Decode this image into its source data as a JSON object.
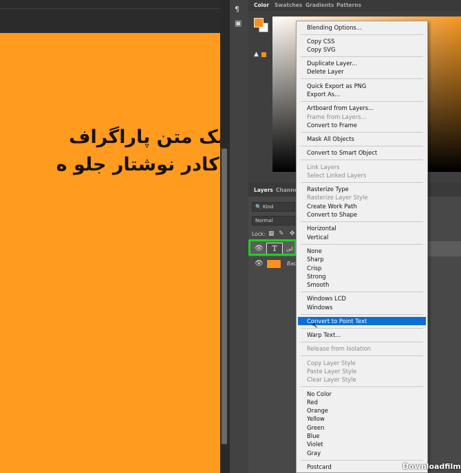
{
  "canvas": {
    "line1": "این یک متن پاراگراف",
    "line2": "توی کادر نوشتار جلو ه"
  },
  "color_panel": {
    "tabs": [
      "Color",
      "Swatches",
      "Gradients",
      "Patterns"
    ],
    "foreground_color": "#f7901e"
  },
  "layers_panel": {
    "tabs": [
      "Layers",
      "Channels"
    ],
    "kind_filter": "Kind",
    "blend_mode": "Normal",
    "lock_label": "Lock:",
    "text_layer": {
      "thumb": "T",
      "name": "این"
    },
    "background_layer": {
      "name": "Back"
    }
  },
  "context_menu": {
    "items": [
      {
        "label": "Blending Options...",
        "disabled": false
      },
      {
        "label": "Copy CSS",
        "disabled": false
      },
      {
        "label": "Copy SVG",
        "disabled": false
      },
      {
        "label": "Duplicate Layer...",
        "disabled": false
      },
      {
        "label": "Delete Layer",
        "disabled": false
      },
      {
        "label": "Quick Export as PNG",
        "disabled": false
      },
      {
        "label": "Export As...",
        "disabled": false
      },
      {
        "label": "Artboard from Layers...",
        "disabled": false
      },
      {
        "label": "Frame from Layers...",
        "disabled": true
      },
      {
        "label": "Convert to Frame",
        "disabled": false
      },
      {
        "label": "Mask All Objects",
        "disabled": false
      },
      {
        "label": "Convert to Smart Object",
        "disabled": false
      },
      {
        "label": "Link Layers",
        "disabled": true
      },
      {
        "label": "Select Linked Layers",
        "disabled": true
      },
      {
        "label": "Rasterize Type",
        "disabled": false
      },
      {
        "label": "Rasterize Layer Style",
        "disabled": true
      },
      {
        "label": "Create Work Path",
        "disabled": false
      },
      {
        "label": "Convert to Shape",
        "disabled": false
      },
      {
        "label": "Horizontal",
        "disabled": false
      },
      {
        "label": "Vertical",
        "disabled": false
      },
      {
        "label": "None",
        "disabled": false
      },
      {
        "label": "Sharp",
        "disabled": false
      },
      {
        "label": "Crisp",
        "disabled": false
      },
      {
        "label": "Strong",
        "disabled": false
      },
      {
        "label": "Smooth",
        "disabled": false
      },
      {
        "label": "Windows LCD",
        "disabled": false
      },
      {
        "label": "Windows",
        "disabled": false
      },
      {
        "label": "Convert to Point Text",
        "disabled": false,
        "selected": true
      },
      {
        "label": "Warp Text...",
        "disabled": false
      },
      {
        "label": "Release from Isolation",
        "disabled": true
      },
      {
        "label": "Copy Layer Style",
        "disabled": true
      },
      {
        "label": "Paste Layer Style",
        "disabled": true
      },
      {
        "label": "Clear Layer Style",
        "disabled": true
      },
      {
        "label": "No Color",
        "disabled": false
      },
      {
        "label": "Red",
        "disabled": false
      },
      {
        "label": "Orange",
        "disabled": false
      },
      {
        "label": "Yellow",
        "disabled": false
      },
      {
        "label": "Green",
        "disabled": false
      },
      {
        "label": "Blue",
        "disabled": false
      },
      {
        "label": "Violet",
        "disabled": false
      },
      {
        "label": "Gray",
        "disabled": false
      },
      {
        "label": "Postcard",
        "disabled": false
      }
    ]
  },
  "watermark": "Downloadfilm.ir"
}
